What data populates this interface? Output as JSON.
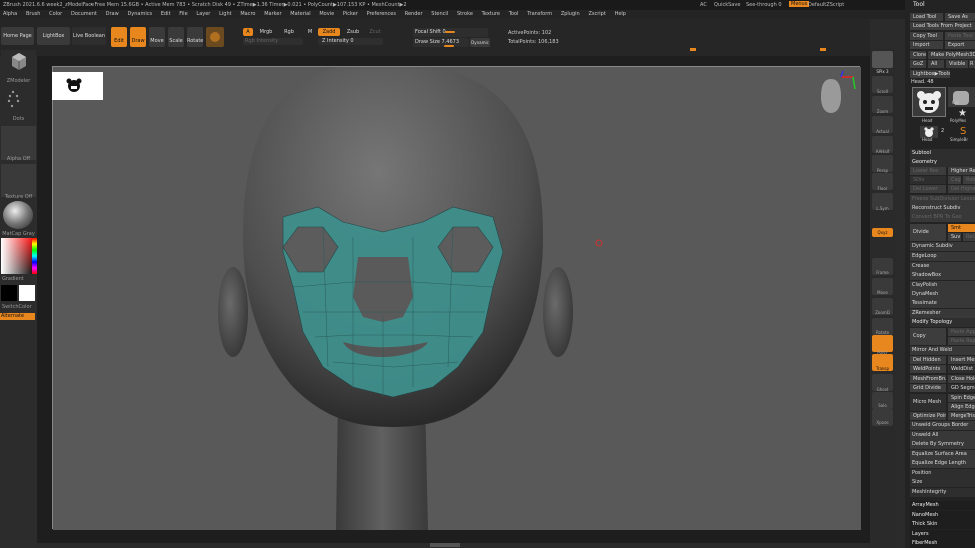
{
  "title_bar": {
    "app": "ZBrush 2021.6.6 week2_zModelFace",
    "stats": "• Free Mem 15.6GB • Active Mem 783 • Scratch Disk 49 • ZTime▶1.36 Timer▶0.021 • PolyCount▶107.153 KP • MeshCount▶2",
    "ac": "AC",
    "quicksave": "QuickSave",
    "see_through": "See-through  0",
    "menus": "Menus",
    "default_zscript": "DefaultZScript"
  },
  "menus": [
    "Alpha",
    "Brush",
    "Color",
    "Document",
    "Draw",
    "Dynamics",
    "Edit",
    "File",
    "Layer",
    "Light",
    "Macro",
    "Marker",
    "Material",
    "Movie",
    "Picker",
    "Preferences",
    "Render",
    "Stencil",
    "Stroke",
    "Texture",
    "Tool",
    "Transform",
    "Zplugin",
    "Zscript",
    "Help"
  ],
  "toolbar": {
    "home_page": "Home Page",
    "lightbox": "LightBox",
    "live_boolean": "Live Boolean",
    "edit": "Edit",
    "draw": "Draw",
    "move": "Move",
    "scale": "Scale",
    "rotate": "Rotate",
    "a": "A",
    "mrgb": "Mrgb",
    "rgb": "Rgb",
    "m": "M",
    "zadd": "Zadd",
    "zsub": "Zsub",
    "zcut": "Zcut",
    "rgb_intensity": "Rgb Intensity",
    "z_intensity": "Z Intensity 0",
    "focal_shift": "Focal Shift 0",
    "draw_size": "Draw Size 7.4673",
    "dynamic": "Dynamic",
    "active_points": "ActivePoints: 102",
    "total_points": "TotalPoints: 106,183"
  },
  "left_shelf": {
    "zmodeler": "ZModeler",
    "dots": "Dots",
    "alpha_off": "Alpha Off",
    "texture_off": "Texture Off",
    "matcap": "MatCap Gray",
    "gradient": "Gradient",
    "switch_color": "SwitchColor",
    "alternate": "Alternate"
  },
  "right_shelf": [
    "SPix 3",
    "Scroll",
    "Zoom",
    "Actual",
    "AAHalf",
    "Persp",
    "Floor",
    "L.Sym",
    "Qxyz",
    "Frame",
    "Move",
    "ZoomD",
    "Rotate",
    "PolyF",
    "Transp",
    "Ghost",
    "Solo",
    "Xpose"
  ],
  "tool_panel": {
    "title": "Tool",
    "load_tool": "Load Tool",
    "save_as": "Save As",
    "load_tools_from_project": "Load Tools From Project",
    "copy_tool": "Copy Tool",
    "paste_tool": "Paste Tool",
    "import": "Import",
    "export": "Export",
    "clone": "Clone",
    "make_polymesh3d": "Make PolyMesh3D",
    "goz": "GoZ",
    "all": "All",
    "visible": "Visible",
    "r": "R",
    "lightbox_tools": "Lightbox▶Tools",
    "head_48": "Head. 48",
    "thumb_head": "Head",
    "thumb_cyl": "Cyli",
    "thumb_poly": "PolyMes",
    "thumb_head2": "Head",
    "thumb_count": "2",
    "thumb_simple": "SimpleBr",
    "subtool": "Subtool",
    "geometry": "Geometry",
    "lower_res": "Lower Res",
    "higher_res": "Higher Res",
    "sdiv": "SDiv",
    "cage": "Cage",
    "rstr": "Rstr",
    "del_lower": "Del Lower",
    "del_higher": "Del Higher",
    "freeze_subdivision": "Freeze SubDivision Levels",
    "reconstruct_subdiv": "Reconstruct Subdiv",
    "convert_bpr": "Convert BPR To Geo",
    "divide": "Divide",
    "smt": "Smt",
    "suv": "Suv",
    "rsm": "ReUV",
    "dynamic_subdiv": "Dynamic Subdiv",
    "edgeloop": "EdgeLoop",
    "crease": "Crease",
    "shadowbox": "ShadowBox",
    "clayPolish": "ClayPolish",
    "dynamesh": "DynaMesh",
    "tessimate": "Tessimate",
    "zremesher": "ZRemesher",
    "modify_topology": "Modify Topology",
    "copy": "Copy",
    "paste_append": "Paste Append",
    "paste_replace": "Paste Replace",
    "mirror_and_weld": "Mirror And Weld",
    "del_hidden": "Del Hidden",
    "insert_mesh": "Insert Mesh",
    "weld_points": "WeldPoints",
    "weld_dist": "WeldDist 1",
    "mesh_from_brush": "MeshFromBrush",
    "close_holes": "Close Holes",
    "grid_divide": "Grid Divide",
    "gd_segments": "GD Segments",
    "micro_mesh": "Micro Mesh",
    "spin_edge": "Spin Edge",
    "align_edge": "Align Edge",
    "optimize_points": "Optimize Points",
    "merge_tris": "MergeTris",
    "unweld_groups_border": "Unweld Groups Border",
    "unweld_all": "Unweld All",
    "delete_by_symmetry": "Delete By Symmetry",
    "equalize_surface_area": "Equalize Surface Area",
    "equalize_edge_length": "Equalize Edge Length",
    "position": "Position",
    "size": "Size",
    "mesh_integrity": "MeshIntegrity",
    "arraymesh": "ArrayMesh",
    "nanomesh": "NanoMesh",
    "thick_skin": "Thick Skin",
    "layers": "Layers",
    "fibermesh": "FiberMesh"
  }
}
